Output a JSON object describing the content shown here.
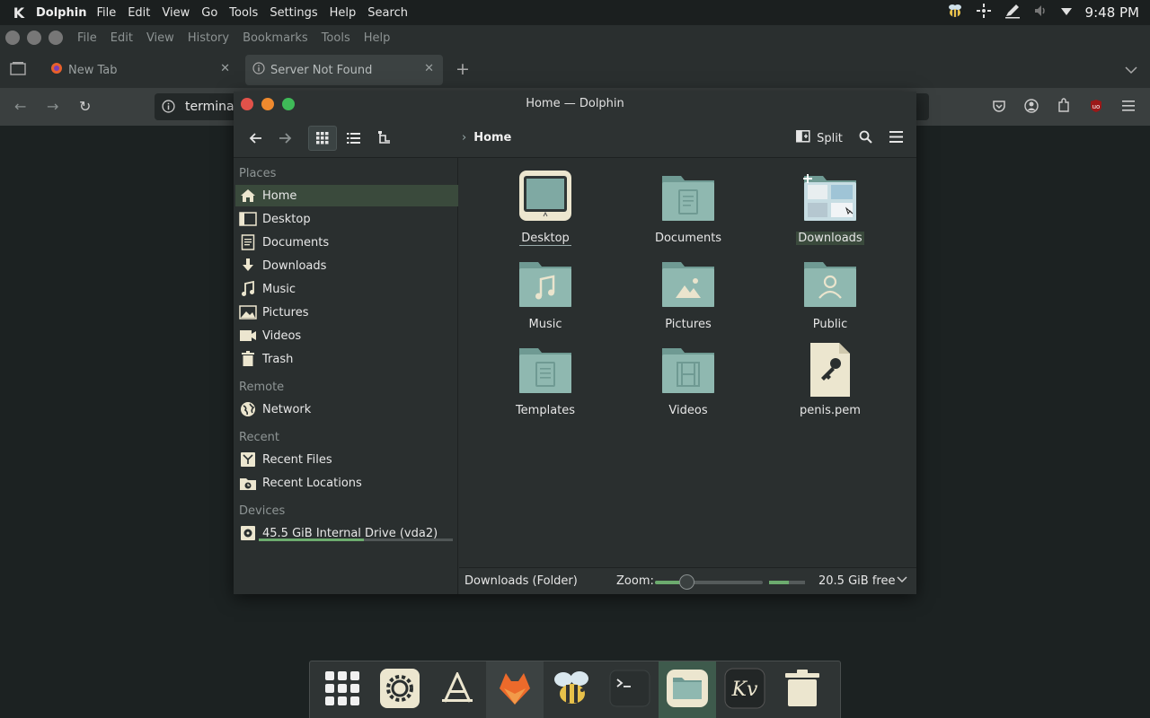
{
  "top_panel": {
    "logo": "K",
    "app_name": "Dolphin",
    "menus": [
      "File",
      "Edit",
      "View",
      "Go",
      "Tools",
      "Settings",
      "Help",
      "Search"
    ],
    "clock": "9:48 PM",
    "tray_icons": [
      "bee-icon",
      "network-icon",
      "pen-icon",
      "volume-icon",
      "chevron-down-icon"
    ]
  },
  "firefox": {
    "menus": [
      "File",
      "Edit",
      "View",
      "History",
      "Bookmarks",
      "Tools",
      "Help"
    ],
    "tabs": [
      {
        "title": "New Tab",
        "icon": "firefox-icon"
      },
      {
        "title": "Server Not Found",
        "icon": "info-icon"
      }
    ],
    "new_tab": "+",
    "url_text": "terminal"
  },
  "dolphin": {
    "window_title": "Home — Dolphin",
    "breadcrumb": "Home",
    "split_label": "Split",
    "places": {
      "sections": {
        "places": "Places",
        "remote": "Remote",
        "recent": "Recent",
        "devices": "Devices"
      },
      "items": {
        "home": "Home",
        "desktop": "Desktop",
        "documents": "Documents",
        "downloads": "Downloads",
        "music": "Music",
        "pictures": "Pictures",
        "videos": "Videos",
        "trash": "Trash",
        "network": "Network",
        "recent_files": "Recent Files",
        "recent_locations": "Recent Locations",
        "drive": "45.5 GiB Internal Drive (vda2)"
      },
      "drive_used_fraction": 0.54
    },
    "files": [
      {
        "name": "Desktop",
        "type": "desktop"
      },
      {
        "name": "Documents",
        "type": "folder-documents"
      },
      {
        "name": "Downloads",
        "type": "folder-downloads"
      },
      {
        "name": "Music",
        "type": "folder-music"
      },
      {
        "name": "Pictures",
        "type": "folder-pictures"
      },
      {
        "name": "Public",
        "type": "folder-public"
      },
      {
        "name": "Templates",
        "type": "folder-templates"
      },
      {
        "name": "Videos",
        "type": "folder-videos"
      },
      {
        "name": "penis.pem",
        "type": "key-file"
      }
    ],
    "status": {
      "text": "Downloads (Folder)",
      "zoom_label": "Zoom:",
      "zoom_fraction": 0.28,
      "free_text": "20.5 GiB free",
      "disk_used_fraction": 0.55
    }
  },
  "dock_items": [
    "app-grid-icon",
    "settings-icon",
    "text-editor-icon",
    "firefox-icon",
    "bee-icon",
    "terminal-icon",
    "file-manager-icon",
    "kvantum-icon",
    "trash-icon"
  ],
  "colors": {
    "accent_green": "#6cab6e",
    "folder_teal": "#8fb8b0",
    "highlight": "#3a4a3c"
  }
}
